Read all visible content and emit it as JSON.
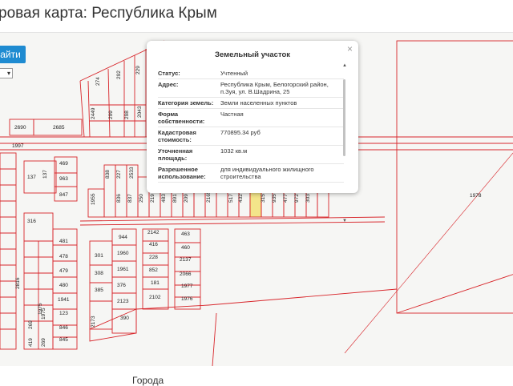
{
  "page_title": "ровая карта: Республика Крым",
  "search_button_label": "айти",
  "footer_label": "Города",
  "popup": {
    "title": "Земельный участок",
    "close": "×",
    "rows": [
      {
        "label": "Статус:",
        "value": "Учтенный"
      },
      {
        "label": "Адрес:",
        "value": "Республика Крым, Белогорский район, п.Зуя, ул. В.Шадрина, 25"
      },
      {
        "label": "Категория земель:",
        "value": "Земли населенных пунктов"
      },
      {
        "label": "Форма собственности:",
        "value": "Частная"
      },
      {
        "label": "Кадастровая стоимость:",
        "value": "770895.34 руб"
      },
      {
        "label": "Уточненная площадь:",
        "value": "1032 кв.м"
      },
      {
        "label": "Разрешенное использование:",
        "value": "для индивидуального жилищного строительства"
      }
    ]
  },
  "map": {
    "line_color": "#d8262b",
    "highlight_color": "#f3e58a",
    "labels": [
      {
        "t": "274"
      },
      {
        "t": "292"
      },
      {
        "t": "229"
      },
      {
        "t": "2449"
      },
      {
        "t": "299"
      },
      {
        "t": "298"
      },
      {
        "t": "2043"
      },
      {
        "t": "2690"
      },
      {
        "t": "2685"
      },
      {
        "t": "1997"
      },
      {
        "t": "469"
      },
      {
        "t": "963"
      },
      {
        "t": "847"
      },
      {
        "t": "137"
      },
      {
        "t": "137"
      },
      {
        "t": "838"
      },
      {
        "t": "227"
      },
      {
        "t": "2533"
      },
      {
        "t": "1955"
      },
      {
        "t": "836"
      },
      {
        "t": "837"
      },
      {
        "t": "250"
      },
      {
        "t": "219"
      },
      {
        "t": "483"
      },
      {
        "t": "891"
      },
      {
        "t": "209"
      },
      {
        "t": "2165"
      },
      {
        "t": "517"
      },
      {
        "t": "432"
      },
      {
        "t": "315"
      },
      {
        "t": "935"
      },
      {
        "t": "477"
      },
      {
        "t": "972"
      },
      {
        "t": "303"
      },
      {
        "t": "1978"
      },
      {
        "t": "316"
      },
      {
        "t": "481"
      },
      {
        "t": "478"
      },
      {
        "t": "479"
      },
      {
        "t": "480"
      },
      {
        "t": "1941"
      },
      {
        "t": "1975"
      },
      {
        "t": "123"
      },
      {
        "t": "846"
      },
      {
        "t": "845"
      },
      {
        "t": "944"
      },
      {
        "t": "301"
      },
      {
        "t": "1960"
      },
      {
        "t": "308"
      },
      {
        "t": "1961"
      },
      {
        "t": "385"
      },
      {
        "t": "376"
      },
      {
        "t": "2123"
      },
      {
        "t": "390"
      },
      {
        "t": "2173"
      },
      {
        "t": "2142"
      },
      {
        "t": "416"
      },
      {
        "t": "228"
      },
      {
        "t": "852"
      },
      {
        "t": "181"
      },
      {
        "t": "2102"
      },
      {
        "t": "463"
      },
      {
        "t": "460"
      },
      {
        "t": "2137"
      },
      {
        "t": "2066"
      },
      {
        "t": "1977"
      },
      {
        "t": "1976"
      },
      {
        "t": "2816"
      },
      {
        "t": "419"
      },
      {
        "t": "269"
      },
      {
        "t": "269"
      },
      {
        "t": "1975"
      }
    ]
  }
}
